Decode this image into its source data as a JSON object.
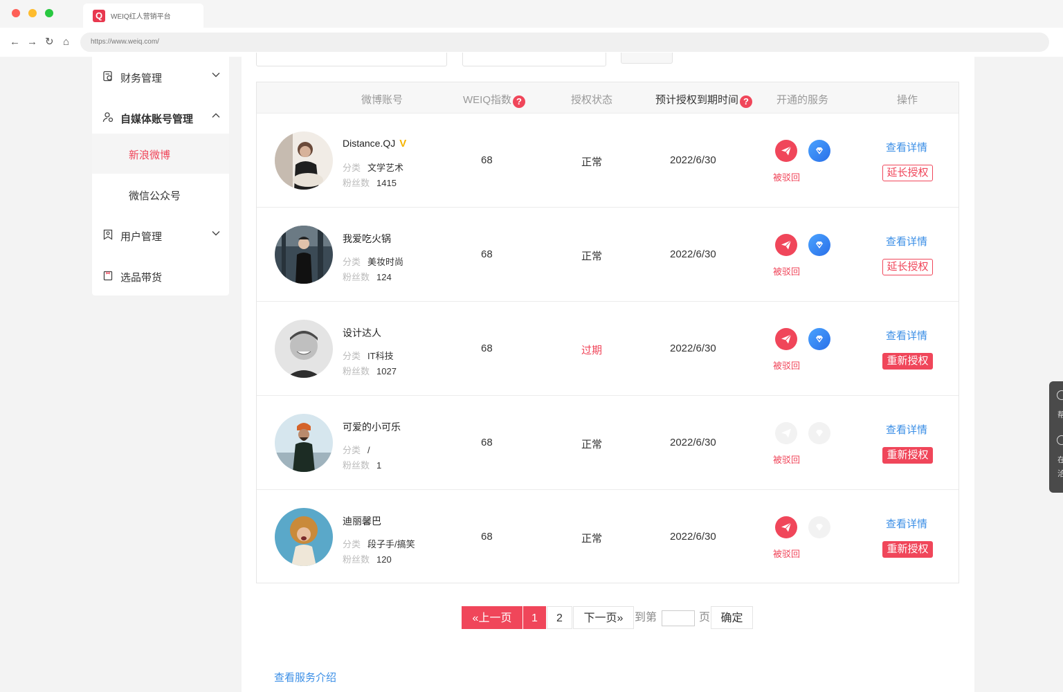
{
  "browser": {
    "tab_title": "WEIQ红人营销平台",
    "tab_logo": "Q",
    "url": "https://www.weiq.com/"
  },
  "sidebar": {
    "finance": "财务管理",
    "media": "自媒体账号管理",
    "sub_weibo": "新浪微博",
    "sub_wechat": "微信公众号",
    "user": "用户管理",
    "goods": "选品带货"
  },
  "table": {
    "headers": {
      "account": "微博账号",
      "weiq_index": "WEIQ指数",
      "auth_status": "授权状态",
      "expire_time": "预计授权到期时间",
      "services": "开通的服务",
      "actions": "操作"
    },
    "qmark": "?",
    "category_label": "分类",
    "fans_label": "粉丝数",
    "rejected_label": "被驳回",
    "detail_label": "查看详情",
    "rows": [
      {
        "name": "Distance.QJ",
        "verified": "V",
        "category": "文学艺术",
        "fans": "1415",
        "index": "68",
        "status": "正常",
        "expire": "2022/6/30",
        "action": "延长授权"
      },
      {
        "name": "我爱吃火锅",
        "category": "美妆时尚",
        "fans": "124",
        "index": "68",
        "status": "正常",
        "expire": "2022/6/30",
        "action": "延长授权"
      },
      {
        "name": "设计达人",
        "category": "IT科技",
        "fans": "1027",
        "index": "68",
        "status": "过期",
        "expire": "2022/6/30",
        "action": "重新授权"
      },
      {
        "name": "可爱的小可乐",
        "category": "/",
        "fans": "1",
        "index": "68",
        "status": "正常",
        "expire": "2022/6/30",
        "action": "重新授权"
      },
      {
        "name": "迪丽馨巴",
        "category": "段子手/搞笑",
        "fans": "120",
        "index": "68",
        "status": "正常",
        "expire": "2022/6/30",
        "action": "重新授权"
      }
    ]
  },
  "pagination": {
    "prev": "«上一页",
    "page1": "1",
    "page2": "2",
    "next": "下一页»",
    "goto": "到第",
    "page_unit": "页",
    "confirm": "确定"
  },
  "footer": {
    "service_intro": "查看服务介绍"
  },
  "helper": {
    "t1": "帮",
    "t2": "在",
    "t3": "洽"
  },
  "colors": {
    "accent": "#f0465a",
    "link": "#3a8ee6"
  }
}
